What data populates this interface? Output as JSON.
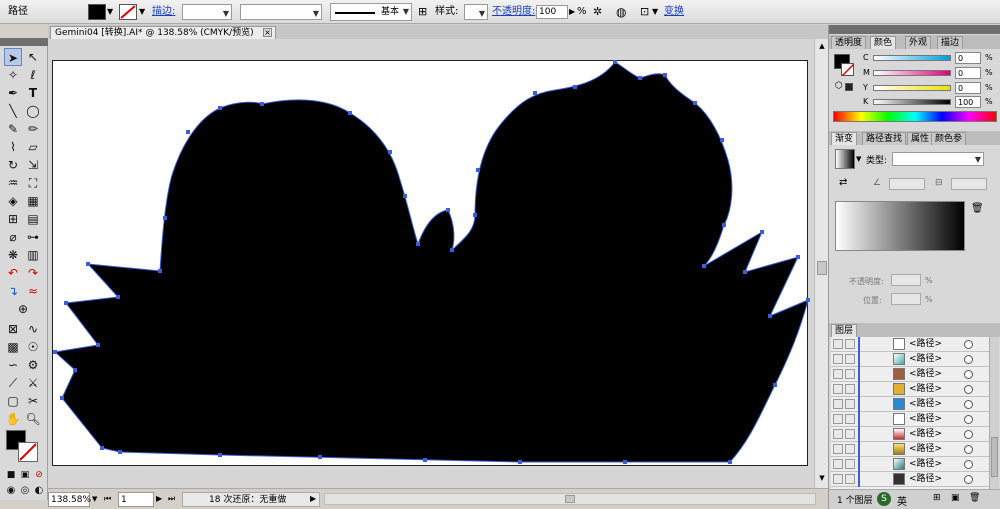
{
  "control_bar": {
    "object_type": "路径",
    "stroke_label": "描边:",
    "stroke_style": "基本",
    "style_label": "样式:",
    "opacity_label": "不透明度:",
    "opacity_value": "100",
    "opacity_unit": "%",
    "transform_link": "变换"
  },
  "document_tab": {
    "title": "Gemini04 [转换].AI* @ 138.58% (CMYK/预览)",
    "close_glyph": "×"
  },
  "status_bar": {
    "zoom": "138.58%",
    "artboard": "1",
    "history": "18 次还原：无重做"
  },
  "color_panel": {
    "tabs": [
      "透明度",
      "颜色",
      "外观",
      "描边"
    ],
    "active_tab": "颜色",
    "channels": [
      {
        "label": "C",
        "value": "0"
      },
      {
        "label": "M",
        "value": "0"
      },
      {
        "label": "Y",
        "value": "0"
      },
      {
        "label": "K",
        "value": "100"
      }
    ],
    "unit": "%"
  },
  "gradient_panel": {
    "tabs": [
      "渐变",
      "路径查找",
      "属性",
      "颜色参"
    ],
    "active_tab": "渐变",
    "type_label": "类型:",
    "opacity_label": "不透明度:",
    "location_label": "位置:",
    "unit": "%"
  },
  "layers_panel": {
    "title": "图层",
    "rows": [
      "<路径>",
      "<路径>",
      "<路径>",
      "<路径>",
      "<路径>",
      "<路径>",
      "<路径>",
      "<路径>",
      "<路径>",
      "<路径>"
    ],
    "footer": "1 个图层",
    "ime_indicator": "英"
  },
  "colors": {
    "shape_fill": "#000000",
    "anchor": "#3d5ed6",
    "panel_bg": "#d8d8d8"
  }
}
